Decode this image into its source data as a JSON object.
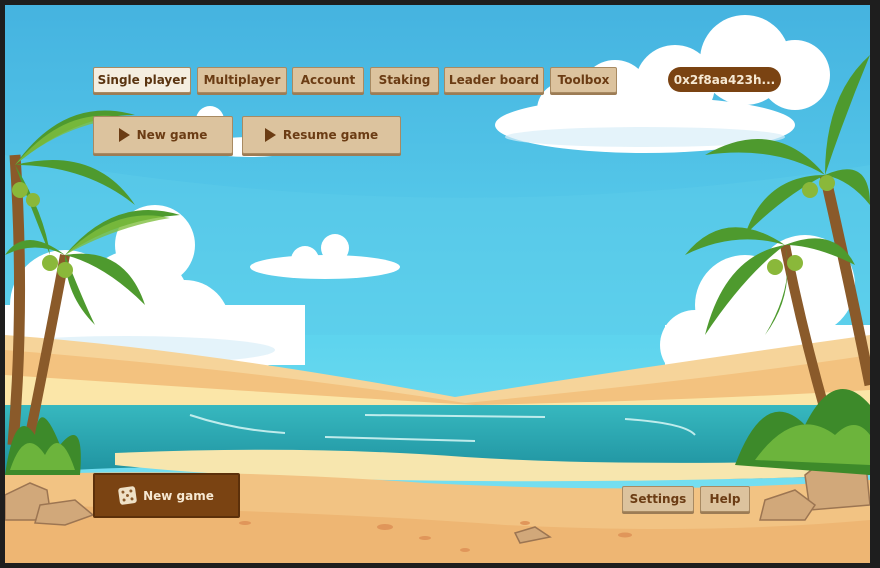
{
  "menu": {
    "tabs": [
      {
        "label": "Single player",
        "active": true
      },
      {
        "label": "Multiplayer",
        "active": false
      },
      {
        "label": "Account",
        "active": false
      },
      {
        "label": "Staking",
        "active": false
      },
      {
        "label": "Leader board",
        "active": false
      },
      {
        "label": "Toolbox",
        "active": false
      }
    ],
    "wallet_address": "0x2f8aa423h..."
  },
  "actions": {
    "new_game_label": "New game",
    "resume_game_label": "Resume game"
  },
  "footer": {
    "new_game_label": "New game",
    "settings_label": "Settings",
    "help_label": "Help"
  },
  "theme": {
    "button_bg": "#dcc39e",
    "button_text": "#6b3c14",
    "accent_brown": "#7a4312",
    "sky": "#4fc0e6",
    "sand": "#f3c27f",
    "sea": "#2aa9b4"
  }
}
